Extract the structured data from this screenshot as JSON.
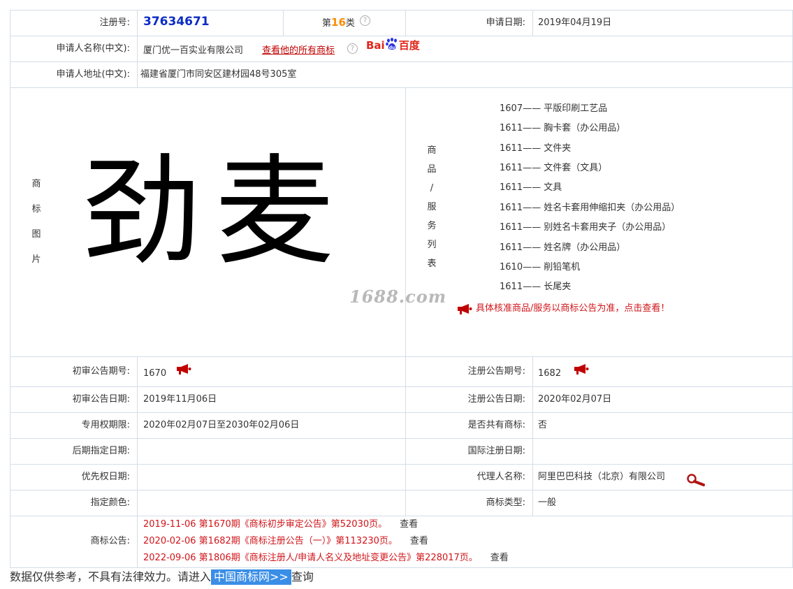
{
  "registration": {
    "label": "注册号:",
    "number": "37634671",
    "class_prefix": "第",
    "class_number": "16",
    "class_suffix": "类",
    "apply_date_label": "申请日期:",
    "apply_date": "2019年04月19日"
  },
  "applicant": {
    "name_label": "申请人名称(中文):",
    "name": "厦门优一百实业有限公司",
    "all_marks_link": "查看他的所有商标",
    "baidu_text_a": "Bai",
    "baidu_text_b": "百度",
    "address_label": "申请人地址(中文):",
    "address": "福建省厦门市同安区建材园48号305室"
  },
  "trademark": {
    "image_label_chars": [
      "商",
      "标",
      "图",
      "片"
    ],
    "image_text": "劲麦",
    "watermark": "1688.com"
  },
  "goods": {
    "label_chars": [
      "商",
      "品",
      "/",
      "服",
      "务",
      "列",
      "表"
    ],
    "items": [
      {
        "code": "1607——",
        "name": "平版印刷工艺品"
      },
      {
        "code": "1611——",
        "name": "胸卡套（办公用品）"
      },
      {
        "code": "1611——",
        "name": "文件夹"
      },
      {
        "code": "1611——",
        "name": "文件套（文具）"
      },
      {
        "code": "1611——",
        "name": "文具"
      },
      {
        "code": "1611——",
        "name": "姓名卡套用伸缩扣夹（办公用品）"
      },
      {
        "code": "1611——",
        "name": "别姓名卡套用夹子（办公用品）"
      },
      {
        "code": "1611——",
        "name": "姓名牌（办公用品）"
      },
      {
        "code": "1610——",
        "name": "削铅笔机"
      },
      {
        "code": "1611——",
        "name": "长尾夹"
      }
    ],
    "notice": "具体核准商品/服务以商标公告为准，点击查看！"
  },
  "details": {
    "prelim_no_label": "初审公告期号:",
    "prelim_no": "1670",
    "reg_no_label": "注册公告期号:",
    "reg_no": "1682",
    "prelim_date_label": "初审公告日期:",
    "prelim_date": "2019年11月06日",
    "reg_date_label": "注册公告日期:",
    "reg_date": "2020年02月07日",
    "exclusive_label": "专用权期限:",
    "exclusive": "2020年02月07日至2030年02月06日",
    "shared_label": "是否共有商标:",
    "shared": "否",
    "later_label": "后期指定日期:",
    "later": "",
    "intl_label": "国际注册日期:",
    "intl": "",
    "priority_label": "优先权日期:",
    "priority": "",
    "agent_label": "代理人名称:",
    "agent": "阿里巴巴科技（北京）有限公司",
    "color_label": "指定颜色:",
    "color": "",
    "type_label": "商标类型:",
    "type": "一般"
  },
  "announcements": {
    "label": "商标公告:",
    "view_label": "查看",
    "items": [
      "2019-11-06 第1670期《商标初步审定公告》第52030页。",
      "2020-02-06 第1682期《商标注册公告（一）》第113230页。",
      "2022-09-06 第1806期《商标注册人/申请人名义及地址变更公告》第228017页。"
    ]
  },
  "footer": {
    "prefix": "数据仅供参考，不具有法律效力。请进入",
    "button": "中国商标网>>",
    "suffix": "查询"
  },
  "colors": {
    "reg_number": "#0b2cc4",
    "class_number": "#ff8a00",
    "alert_red": "#d0151a",
    "link_red": "#c00000",
    "button_blue": "#3a8ee6",
    "grid_line": "#d4dde8"
  }
}
